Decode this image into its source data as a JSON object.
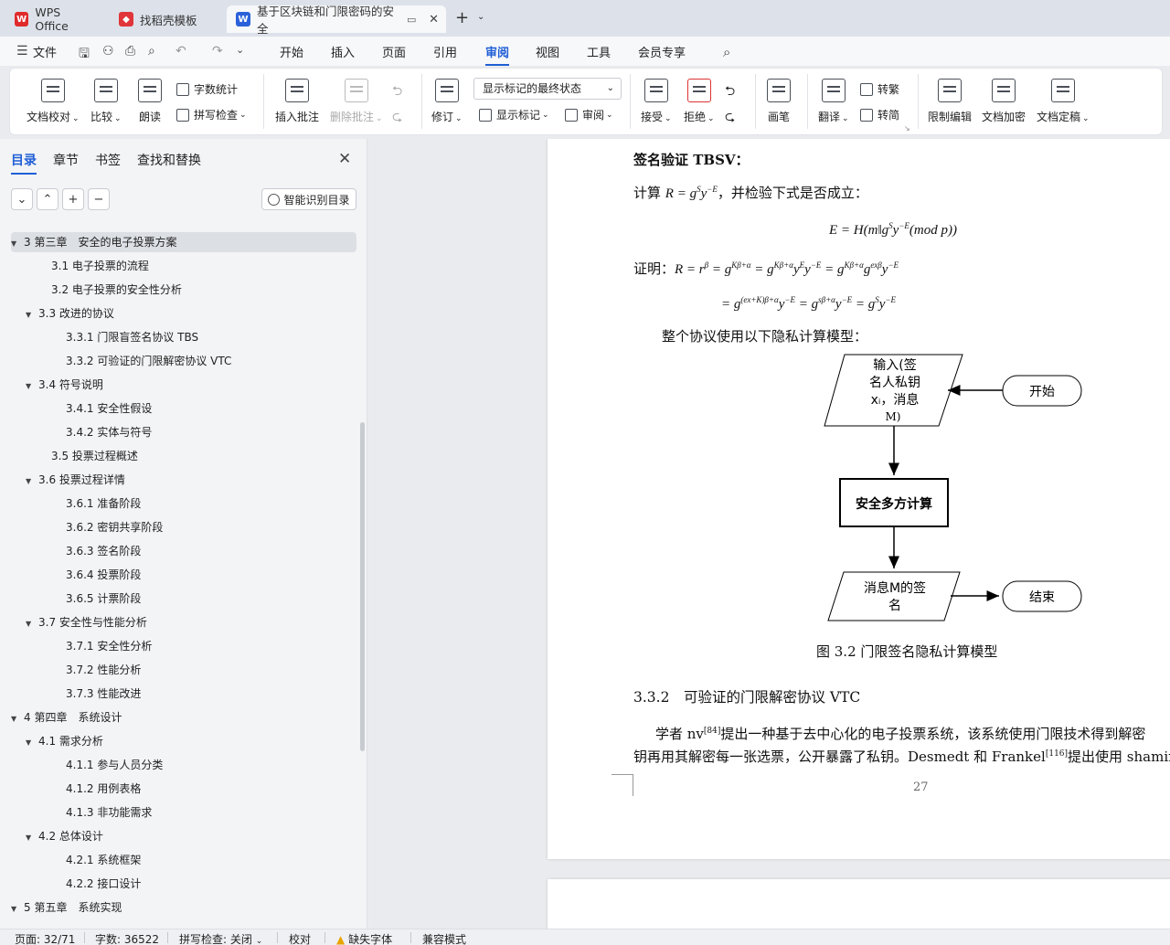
{
  "tabs": [
    {
      "label": "WPS Office",
      "icon": "wps-logo-icon",
      "color": "#e02b2b"
    },
    {
      "label": "找稻壳模板",
      "icon": "docer-icon",
      "color": "#e0353a"
    },
    {
      "label": "基于区块链和门限密码的安全",
      "icon": "word-doc-icon",
      "color": "#2b62d9"
    }
  ],
  "tab_new": "+",
  "menu": {
    "file": "文件",
    "items": [
      "开始",
      "插入",
      "页面",
      "引用",
      "审阅",
      "视图",
      "工具",
      "会员专享"
    ],
    "active": "审阅"
  },
  "ribbon": {
    "proofread": "文档校对",
    "compare": "比较",
    "read_aloud": "朗读",
    "word_count": "字数统计",
    "spell_check": "拼写检查",
    "insert_comment": "插入批注",
    "delete_comment": "删除批注",
    "track_changes": "修订",
    "markup_state": "显示标记的最终状态",
    "show_markup": "显示标记",
    "review": "审阅",
    "accept": "接受",
    "reject": "拒绝",
    "ink": "画笔",
    "translate": "翻译",
    "to_traditional": "转繁",
    "to_simplified": "转简",
    "restrict_edit": "限制编辑",
    "encrypt": "文档加密",
    "finalize": "文档定稿"
  },
  "panel": {
    "tabs": [
      "目录",
      "章节",
      "书签",
      "查找和替换"
    ],
    "active_tab": "目录",
    "smart_toc": "智能识别目录",
    "toc": [
      {
        "label": "3  第三章　安全的电子投票方案",
        "level": 0,
        "expanded": true,
        "selected": true
      },
      {
        "label": "3.1  电子投票的流程",
        "level": 1
      },
      {
        "label": "3.2  电子投票的安全性分析",
        "level": 1
      },
      {
        "label": "3.3  改进的协议",
        "level": 1,
        "expanded": true
      },
      {
        "label": "3.3.1  门限盲签名协议 TBS",
        "level": 2
      },
      {
        "label": "3.3.2  可验证的门限解密协议 VTC",
        "level": 2
      },
      {
        "label": "3.4  符号说明",
        "level": 1,
        "expanded": true
      },
      {
        "label": "3.4.1  安全性假设",
        "level": 2
      },
      {
        "label": "3.4.2  实体与符号",
        "level": 2
      },
      {
        "label": "3.5  投票过程概述",
        "level": 1
      },
      {
        "label": "3.6  投票过程详情",
        "level": 1,
        "expanded": true
      },
      {
        "label": "3.6.1  准备阶段",
        "level": 2
      },
      {
        "label": "3.6.2  密钥共享阶段",
        "level": 2
      },
      {
        "label": "3.6.3  签名阶段",
        "level": 2
      },
      {
        "label": "3.6.4  投票阶段",
        "level": 2
      },
      {
        "label": "3.6.5  计票阶段",
        "level": 2
      },
      {
        "label": "3.7  安全性与性能分析",
        "level": 1,
        "expanded": true
      },
      {
        "label": "3.7.1  安全性分析",
        "level": 2
      },
      {
        "label": "3.7.2  性能分析",
        "level": 2
      },
      {
        "label": "3.7.3  性能改进",
        "level": 2
      },
      {
        "label": "4  第四章　系统设计",
        "level": 0,
        "expanded": true
      },
      {
        "label": "4.1  需求分析",
        "level": 1,
        "expanded": true
      },
      {
        "label": "4.1.1  参与人员分类",
        "level": 2
      },
      {
        "label": "4.1.2  用例表格",
        "level": 2
      },
      {
        "label": "4.1.3  非功能需求",
        "level": 2
      },
      {
        "label": "4.2  总体设计",
        "level": 1,
        "expanded": true
      },
      {
        "label": "4.2.1  系统框架",
        "level": 2
      },
      {
        "label": "4.2.2  接口设计",
        "level": 2
      },
      {
        "label": "5  第五章　系统实现",
        "level": 0,
        "expanded": true
      }
    ]
  },
  "document": {
    "heading_tbsv": "签名验证 TBSV：",
    "compute_prefix": "计算",
    "compute_suffix": "，并检验下式是否成立：",
    "formula_e": "E = H(m‖g",
    "proof_prefix": "证明：",
    "model_intro": "整个协议使用以下隐私计算模型：",
    "flow": {
      "input": [
        "输入(签",
        "名人私钥",
        "xᵢ，消息",
        "M)"
      ],
      "start": "开始",
      "compute": "安全多方计算",
      "output": [
        "消息M的签",
        "名"
      ],
      "end": "结束"
    },
    "figure_caption": "图 3.2 门限签名隐私计算模型",
    "section_heading": "3.3.2　可验证的门限解密协议 VTC",
    "para1_a": "学者 nv",
    "para1_ref": "[84]",
    "para1_b": "提出一种基于去中心化的电子投票系统，该系统使用门限技术得到解密",
    "para2_a": "钥再用其解密每一张选票，公开暴露了私钥。Desmedt 和 Frankel",
    "para2_ref": "[116]",
    "para2_b": "提出使用 shamir(",
    "page_number": "27"
  },
  "status": {
    "page": "页面: 32/71",
    "words": "字数: 36522",
    "spell": "拼写检查: 关闭",
    "proof": "校对",
    "missing_font": "缺失字体",
    "compat": "兼容模式"
  },
  "colors": {
    "accent": "#1f5fd6",
    "warning": "#e8a400"
  }
}
